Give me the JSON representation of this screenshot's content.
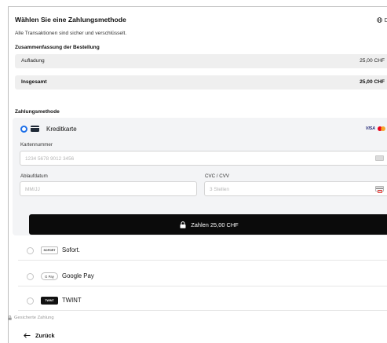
{
  "header": {
    "title": "Wählen Sie eine Zahlungsmethode",
    "language": "DE",
    "subtitle": "Alle Transaktionen sind sicher und verschlüsselt."
  },
  "summary": {
    "title": "Zusammenfassung der Bestellung",
    "rows": [
      {
        "label": "Aufladung",
        "value": "25,00 CHF"
      },
      {
        "label": "Insgesamt",
        "value": "25,00 CHF"
      }
    ]
  },
  "payment": {
    "title": "Zahlungsmethode",
    "card": {
      "label": "Kreditkarte",
      "brands": [
        "VISA",
        "Mastercard"
      ],
      "card_number_label": "Kartennummer",
      "card_number_placeholder": "1234 5678 9012 3456",
      "expiry_label": "Ablaufdatum",
      "expiry_placeholder": "MM/JJ",
      "cvc_label": "CVC / CVV",
      "cvc_placeholder": "3 Stellen",
      "pay_button": "Zahlen 25,00 CHF"
    },
    "options": [
      {
        "label": "Sofort.",
        "logo": "SOFORT",
        "icon": "sofort-logo"
      },
      {
        "label": "Google Pay",
        "logo": "G Pay",
        "icon": "google-pay-logo"
      },
      {
        "label": "TWINT",
        "logo": "TWINT",
        "icon": "twint-logo"
      }
    ]
  },
  "footer": {
    "secure_label": "Gesicherte Zahlung",
    "back_label": "Zurück"
  },
  "colors": {
    "accent": "#1d6fe8",
    "button": "#0b0b0b",
    "summary_bg": "#efefef"
  }
}
